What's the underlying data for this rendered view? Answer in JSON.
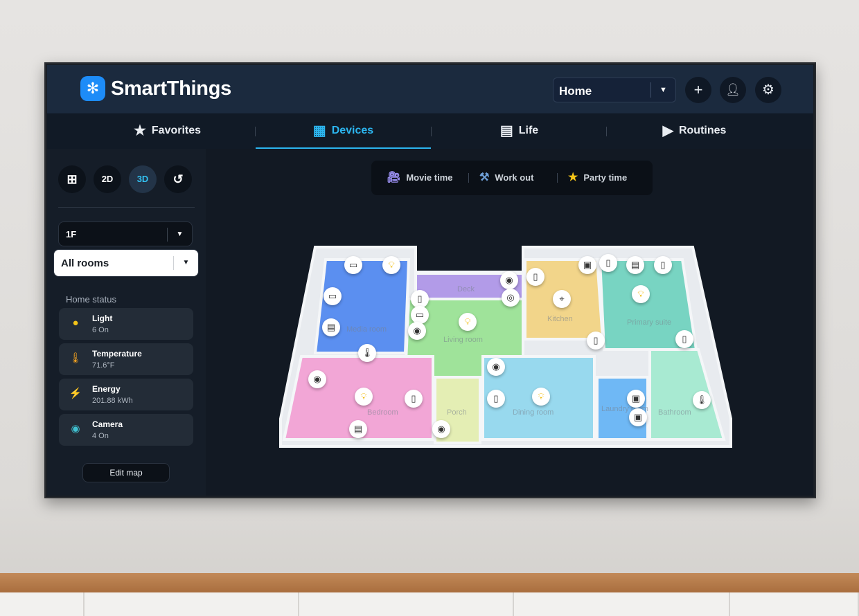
{
  "app": {
    "name": "SmartThings",
    "logo_icon": "smartthings-logo-icon"
  },
  "header": {
    "location": "Home",
    "add_icon": "plus-icon",
    "profile_icon": "person-icon",
    "settings_icon": "gear-icon"
  },
  "tabs": [
    {
      "label": "Favorites",
      "icon": "star-icon"
    },
    {
      "label": "Devices",
      "icon": "devices-grid-icon",
      "active": true
    },
    {
      "label": "Life",
      "icon": "life-icon"
    },
    {
      "label": "Routines",
      "icon": "play-circle-icon"
    }
  ],
  "sidebar": {
    "views": [
      {
        "label": "",
        "icon": "grid-icon"
      },
      {
        "label": "2D"
      },
      {
        "label": "3D",
        "active": true
      },
      {
        "label": "",
        "icon": "rotate-icon"
      }
    ],
    "floor": "1F",
    "room": "All rooms",
    "home_status_title": "Home status",
    "status": [
      {
        "name": "Light",
        "value": "6 On",
        "icon": "bulb-icon",
        "color": "#f5c518"
      },
      {
        "name": "Temperature",
        "value": "71.6°F",
        "icon": "thermometer-icon",
        "color": "#f0a020"
      },
      {
        "name": "Energy",
        "value": "201.88 kWh",
        "icon": "energy-plug-icon",
        "color": "#3aa0f0"
      },
      {
        "name": "Camera",
        "value": "4 On",
        "icon": "camera-icon",
        "color": "#40c0d0"
      }
    ],
    "edit_map": "Edit map"
  },
  "scenes": [
    {
      "label": "Movie time",
      "icon": "movie-camera-icon"
    },
    {
      "label": "Work out",
      "icon": "dumbbell-icon"
    },
    {
      "label": "Party time",
      "icon": "star-icon"
    }
  ],
  "rooms": [
    {
      "name": "Media room",
      "color": "#5b8ff0"
    },
    {
      "name": "Deck",
      "color": "#b29be8"
    },
    {
      "name": "Living room",
      "color": "#9fe39a"
    },
    {
      "name": "Kitchen",
      "color": "#f2d58a"
    },
    {
      "name": "Primary suite",
      "color": "#78d4c2"
    },
    {
      "name": "Bedroom",
      "color": "#f2a6d6"
    },
    {
      "name": "Porch",
      "color": "#e4eeb4"
    },
    {
      "name": "Dining room",
      "color": "#98d9ee"
    },
    {
      "name": "Laundry room",
      "color": "#6fb8f5"
    },
    {
      "name": "Bathroom",
      "color": "#a8ead2"
    }
  ],
  "accent": "#2cb6f0"
}
